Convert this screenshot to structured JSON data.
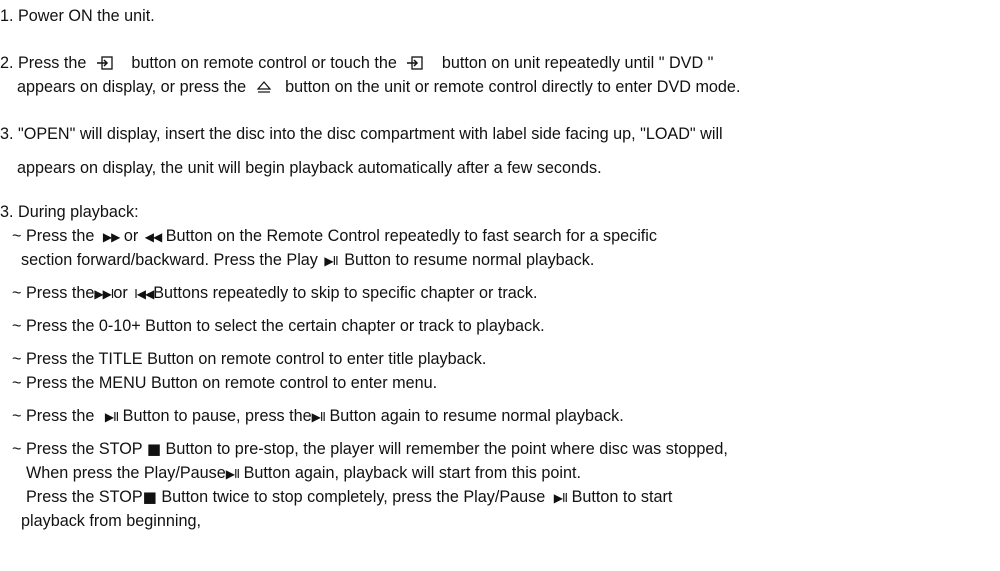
{
  "steps": {
    "step1": "1. Power ON the unit.",
    "step2": {
      "p1": "2. Press the",
      "p2": "button on remote control or touch the",
      "p3": "button   on unit repeatedly until \" DVD \"",
      "p4": "appears on display, or press the",
      "p5": "button on the unit or remote control directly to enter DVD mode."
    },
    "step3a": {
      "line1": "3. \"OPEN\" will display, insert the disc into the disc compartment with label side facing up, \"LOAD\" will",
      "line2": "appears on display, the unit will begin playback automatically after a few seconds."
    },
    "step3b": {
      "heading": "3. During playback:",
      "b1": {
        "p1": "~ Press the",
        "p2": "or",
        "p3": "Button on the Remote Control repeatedly to fast search for a specific",
        "p4": "section forward/backward.  Press the Play",
        "p5": "Button to resume normal playback."
      },
      "b2": {
        "p1": "~ Press the",
        "p2": "or",
        "p3": "Buttons repeatedly to skip to specific chapter or track."
      },
      "b3": "~ Press the  0-10+ Button to select the certain chapter or track to playback.",
      "b4": "~ Press the  TITLE Button on remote control to enter title playback.",
      "b5": "~ Press the  MENU Button on remote control to enter menu.",
      "b6": {
        "p1": "~ Press the",
        "p2": "Button to pause, press the",
        "p3": "Button again to resume normal playback."
      },
      "b7": {
        "p1": "~ Press the STOP",
        "p2": "Button to pre-stop, the player will remember the point where disc was stopped,",
        "p3": "When press the Play/Pause",
        "p4": "Button again, playback will start from this point.",
        "p5": "Press the STOP",
        "p6": "Button twice to stop completely, press the Play/Pause",
        "p7": "Button to start",
        "p8": "playback from beginning,"
      }
    }
  },
  "icons": {
    "ff": "▶▶",
    "rew": "◀◀",
    "playpause": "▶II",
    "next": "▶▶I",
    "prev": "I◀◀",
    "stop": "■",
    "eject": "⏏"
  }
}
